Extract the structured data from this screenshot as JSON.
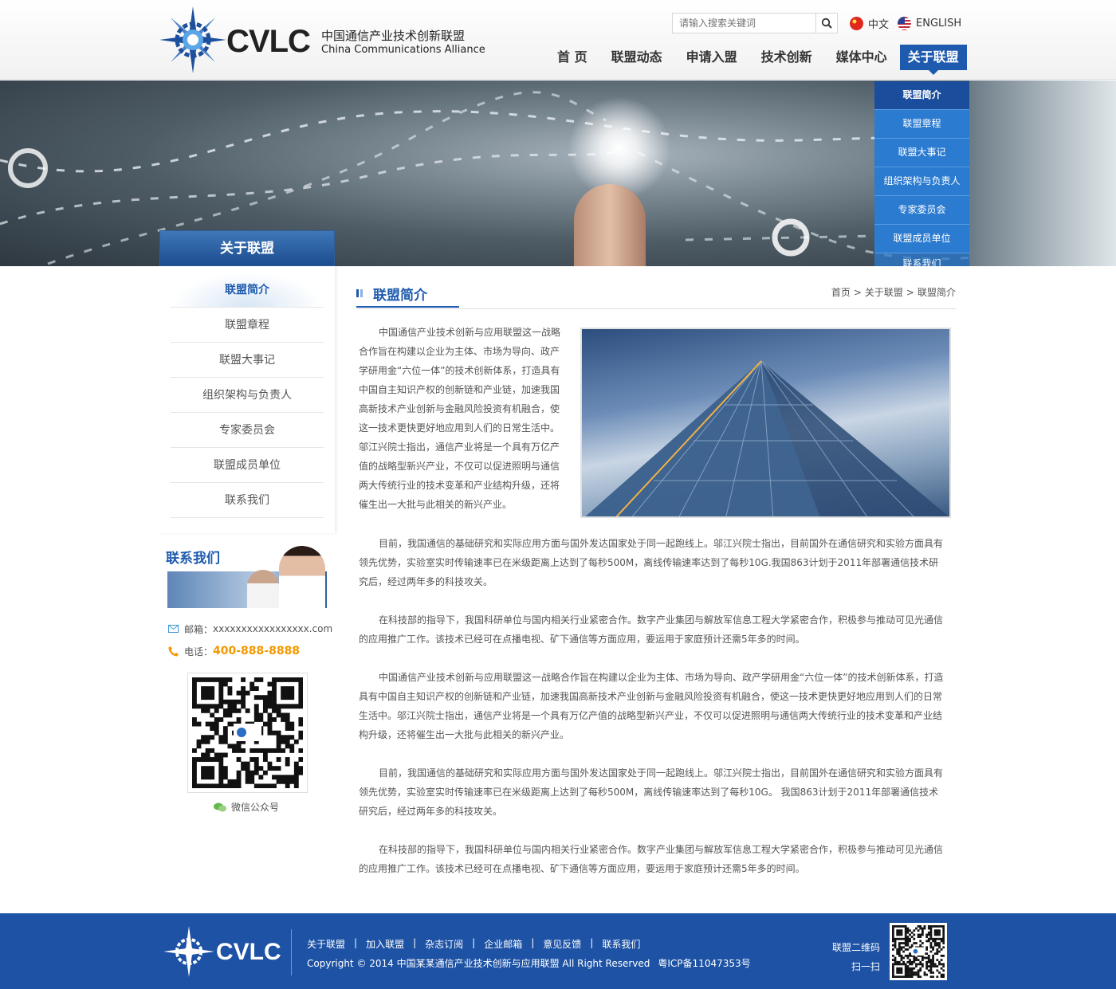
{
  "header": {
    "logo_text": "CVLC",
    "logo_cn": "中国通信产业技术创新联盟",
    "logo_en": "China Communications Alliance",
    "search_placeholder": "请输入搜索关键词",
    "lang_cn": "中文",
    "lang_en": "ENGLISH"
  },
  "nav": {
    "items": [
      "首 页",
      "联盟动态",
      "申请入盟",
      "技术创新",
      "媒体中心",
      "关于联盟"
    ],
    "active_index": 5
  },
  "dropdown": {
    "items": [
      "联盟简介",
      "联盟章程",
      "联盟大事记",
      "组织架构与负责人",
      "专家委员会",
      "联盟成员单位",
      "联系我们"
    ]
  },
  "sidebar": {
    "title": "关于联盟",
    "items": [
      "联盟简介",
      "联盟章程",
      "联盟大事记",
      "组织架构与负责人",
      "专家委员会",
      "联盟成员单位",
      "联系我们"
    ],
    "contact_title": "联系我们",
    "email_label": "邮箱：",
    "email_value": "xxxxxxxxxxxxxxxxx.com",
    "phone_label": "电话：",
    "phone_value": "400-888-8888",
    "qr_caption": "微信公众号"
  },
  "content": {
    "title": "联盟简介",
    "breadcrumb": [
      "首页",
      "关于联盟",
      "联盟简介"
    ],
    "breadcrumb_sep": ">",
    "paragraphs": [
      "中国通信产业技术创新与应用联盟这一战略合作旨在构建以企业为主体、市场为导向、政产学研用金“六位一体”的技术创新体系，打造具有中国自主知识产权的创新链和产业链，加速我国高新技术产业创新与金融风险投资有机融合，使这一技术更快更好地应用到人们的日常生活中。邬江兴院士指出，通信产业将是一个具有万亿产值的战略型新兴产业，不仅可以促进照明与通信两大传统行业的技术变革和产业结构升级，还将催生出一大批与此相关的新兴产业。",
      "目前，我国通信的基础研究和实际应用方面与国外发达国家处于同一起跑线上。邬江兴院士指出，目前国外在通信研究和实验方面具有领先优势，实验室实时传输速率已在米级距离上达到了每秒500M，离线传输速率达到了每秒10G.我国863计划于2011年部署通信技术研究后，经过两年多的科技攻关。",
      "在科技部的指导下，我国科研单位与国内相关行业紧密合作。数字产业集团与解放军信息工程大学紧密合作，积极参与推动可见光通信的应用推广工作。该技术已经可在点播电视、矿下通信等方面应用，要运用于家庭预计还需5年多的时间。",
      "中国通信产业技术创新与应用联盟这一战略合作旨在构建以企业为主体、市场为导向、政产学研用金“六位一体”的技术创新体系，打造具有中国自主知识产权的创新链和产业链，加速我国高新技术产业创新与金融风险投资有机融合，使这一技术更快更好地应用到人们的日常生活中。邬江兴院士指出，通信产业将是一个具有万亿产值的战略型新兴产业，不仅可以促进照明与通信两大传统行业的技术变革和产业结构升级，还将催生出一大批与此相关的新兴产业。",
      "目前，我国通信的基础研究和实际应用方面与国外发达国家处于同一起跑线上。邬江兴院士指出，目前国外在通信研究和实验方面具有领先优势，实验室实时传输速率已在米级距离上达到了每秒500M，离线传输速率达到了每秒10G。 我国863计划于2011年部署通信技术研究后，经过两年多的科技攻关。",
      "在科技部的指导下，我国科研单位与国内相关行业紧密合作。数字产业集团与解放军信息工程大学紧密合作，积极参与推动可见光通信的应用推广工作。该技术已经可在点播电视、矿下通信等方面应用，要运用于家庭预计还需5年多的时间。"
    ]
  },
  "footer": {
    "logo_text": "CVLC",
    "links": [
      "关于联盟",
      "加入联盟",
      "杂志订阅",
      "企业邮箱",
      "意见反馈",
      "联系我们"
    ],
    "link_sep": "|",
    "copyright": "Copyright © 2014 中国某某通信产业技术创新与应用联盟 All Right Reserved",
    "icp": "粤ICP备11047353号",
    "qr_label_1": "联盟二维码",
    "qr_label_2": "扫一扫"
  },
  "colors": {
    "brand_blue": "#1e5aad",
    "dropdown_blue": "#2b7bd1",
    "phone_orange": "#f39800",
    "footer_blue": "#1d52a5"
  }
}
